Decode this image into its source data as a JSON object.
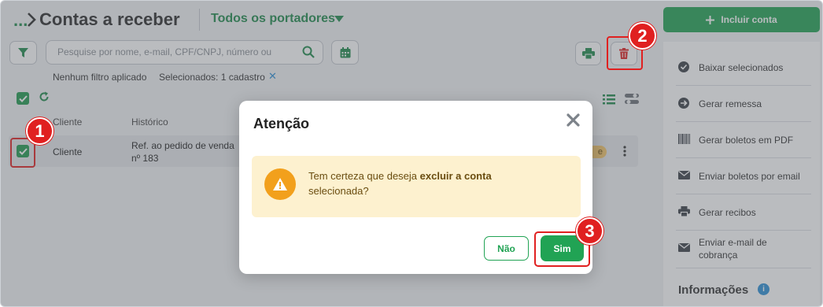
{
  "header": {
    "breadcrumb_ellipsis": "...",
    "title": "Contas a receber",
    "portadores": "Todos os portadores"
  },
  "toolbar": {
    "search_placeholder": "Pesquise por nome, e-mail, CPF/CNPJ, número ou",
    "filter_info": "Nenhum filtro aplicado",
    "selected_info": "Selecionados: 1 cadastro",
    "clear_selection": "✕"
  },
  "table": {
    "columns": [
      "Cliente",
      "Histórico"
    ],
    "rows": [
      {
        "cliente": "Cliente",
        "historico_line1": "Ref. ao pedido de venda",
        "historico_line2": "nº 183",
        "tag": "e",
        "checked": true
      }
    ]
  },
  "sidebar": {
    "add_button": "Incluir conta",
    "actions": [
      {
        "label": "Baixar selecionados",
        "icon": "check-circle-icon"
      },
      {
        "label": "Gerar remessa",
        "icon": "arrow-right-circle-icon"
      },
      {
        "label": "Gerar boletos em PDF",
        "icon": "barcode-icon"
      },
      {
        "label": "Enviar boletos por email",
        "icon": "envelope-icon"
      },
      {
        "label": "Gerar recibos",
        "icon": "printer-icon"
      },
      {
        "label_line1": "Enviar e-mail de",
        "label_line2": "cobrança",
        "icon": "envelope-icon"
      }
    ],
    "info_title": "Informações",
    "info_icon_glyph": "i"
  },
  "modal": {
    "title": "Atenção",
    "message_prefix": "Tem certeza que deseja ",
    "message_bold": "excluir a conta",
    "message_suffix": "selecionada?",
    "cancel_label": "Não",
    "confirm_label": "Sim"
  },
  "annotations": {
    "step1": "1",
    "step2": "2",
    "step3": "3"
  },
  "colors": {
    "brand_green": "#21a354",
    "highlight_red": "#e02020",
    "warning_orange": "#f2a01c",
    "warning_bg": "#fdf1cf",
    "link_blue": "#2b8fd6"
  }
}
